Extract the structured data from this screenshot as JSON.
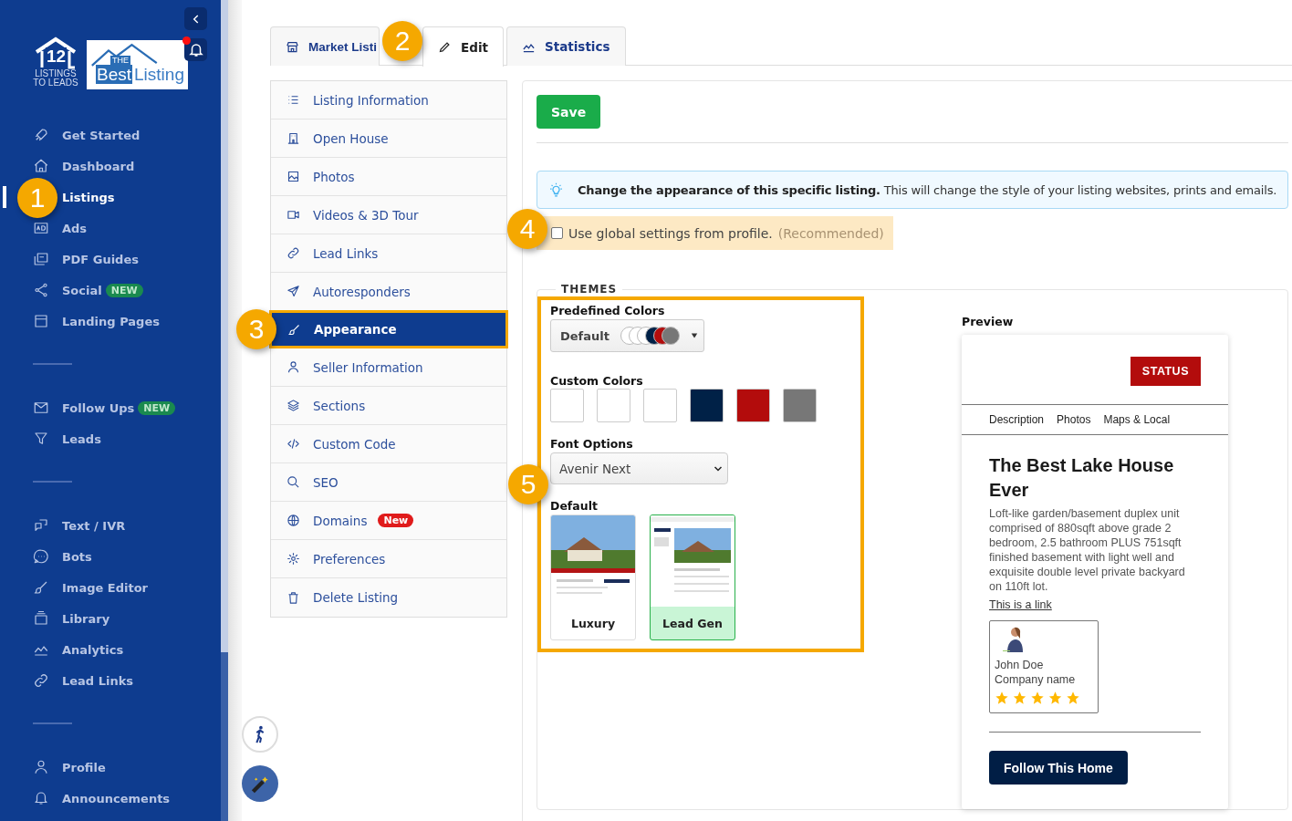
{
  "sidebar": {
    "brand": {
      "mark": "12",
      "line_1": "LISTINGS",
      "line_2": "TO LEADS"
    },
    "client_logo": {
      "small": "THE",
      "word_1": "Best",
      "word_2": "Listing"
    },
    "notifications": {
      "unread": true
    },
    "sections": [
      {
        "items": [
          {
            "label": "Get Started",
            "selected": false
          },
          {
            "label": "Dashboard",
            "selected": false
          },
          {
            "label": "Listings",
            "selected": true
          },
          {
            "label": "Ads",
            "selected": false
          },
          {
            "label": "PDF Guides",
            "selected": false
          },
          {
            "label": "Social",
            "badge": "NEW",
            "selected": false
          },
          {
            "label": "Landing Pages",
            "selected": false
          }
        ]
      },
      {
        "items": [
          {
            "label": "Follow Ups",
            "badge": "NEW",
            "selected": false
          },
          {
            "label": "Leads",
            "selected": false
          }
        ]
      },
      {
        "items": [
          {
            "label": "Text / IVR",
            "selected": false
          },
          {
            "label": "Bots",
            "selected": false
          },
          {
            "label": "Image Editor",
            "selected": false
          },
          {
            "label": "Library",
            "selected": false
          },
          {
            "label": "Analytics",
            "selected": false
          },
          {
            "label": "Lead Links",
            "selected": false
          }
        ]
      },
      {
        "items": [
          {
            "label": "Profile",
            "selected": false
          },
          {
            "label": "Announcements",
            "selected": false
          }
        ]
      }
    ]
  },
  "tabs": [
    {
      "label": "Market Listi",
      "selected": false
    },
    {
      "label": "Edit",
      "selected": true
    },
    {
      "label": "Statistics",
      "selected": false
    }
  ],
  "menu": [
    {
      "label": "Listing Information",
      "selected": false
    },
    {
      "label": "Open House",
      "selected": false
    },
    {
      "label": "Photos",
      "selected": false
    },
    {
      "label": "Videos & 3D Tour",
      "selected": false
    },
    {
      "label": "Lead Links",
      "selected": false
    },
    {
      "label": "Autoresponders",
      "selected": false
    },
    {
      "label": "Appearance",
      "selected": true
    },
    {
      "label": "Seller Information",
      "selected": false
    },
    {
      "label": "Sections",
      "selected": false
    },
    {
      "label": "Custom Code",
      "selected": false
    },
    {
      "label": "SEO",
      "selected": false
    },
    {
      "label": "Domains",
      "badge": "New",
      "selected": false
    },
    {
      "label": "Preferences",
      "selected": false
    },
    {
      "label": "Delete Listing",
      "selected": false
    }
  ],
  "save_button": "Save",
  "alert": "**Change the appearance of this specific listing.** This will change the style of your listing websites, prints and emails.",
  "global_settings": {
    "label": "Use global settings from profile.",
    "hint": "(Recommended)",
    "checked": false
  },
  "themes": {
    "legend": "THEMES",
    "predefined": {
      "label": "Predefined Colors",
      "value": "Default",
      "swatches": [
        {
          "color": "#ffffff"
        },
        {
          "color": "#ffffff"
        },
        {
          "color": "#ffffff"
        },
        {
          "color": "#002147"
        },
        {
          "color": "#b30c0c"
        },
        {
          "color": "#777777"
        }
      ]
    },
    "custom": {
      "label": "Custom Colors",
      "swatches": [
        {
          "color": "#ffffff"
        },
        {
          "color": "#ffffff"
        },
        {
          "color": "#ffffff"
        },
        {
          "color": "#002147"
        },
        {
          "color": "#b30c0c"
        },
        {
          "color": "#777777"
        }
      ]
    },
    "font": {
      "label": "Font Options",
      "value": "Avenir Next"
    },
    "layout": {
      "label": "Default",
      "cards": [
        {
          "name": "Luxury",
          "selected": false
        },
        {
          "name": "Lead Gen",
          "selected": true
        }
      ]
    }
  },
  "preview": {
    "label": "Preview",
    "status": "STATUS",
    "tabs": [
      "Description",
      "Photos",
      "Maps & Local"
    ],
    "title": "The Best Lake House Ever",
    "description": "Loft-like garden/basement duplex unit comprised of 880sqft above grade 2 bedroom, 2.5 bathroom PLUS 751sqft finished basement with light well and exquisite double level private backyard on 110ft lot.",
    "link": "This is a link",
    "agent": {
      "name": "John Doe",
      "company": "Company name",
      "stars": 5
    },
    "button": "Follow This Home"
  },
  "callouts": [
    "1",
    "2",
    "3",
    "4",
    "5"
  ]
}
